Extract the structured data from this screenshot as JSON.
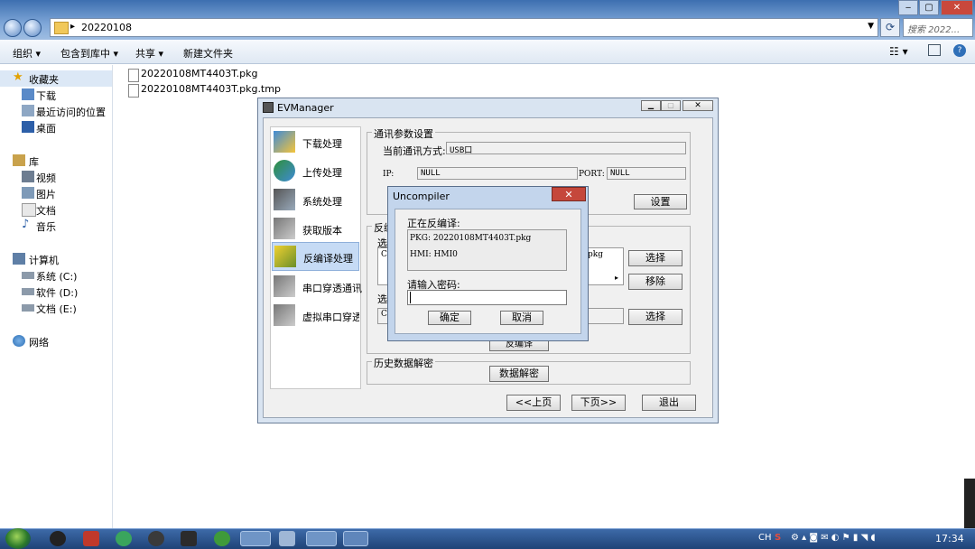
{
  "explorer": {
    "address_path": "20220108",
    "search_placeholder": "搜索 2022...",
    "toolbar": {
      "organize": "组织 ▾",
      "include_library": "包含到库中 ▾",
      "share": "共享 ▾",
      "new_folder": "新建文件夹"
    },
    "sidebar": {
      "favorites": "收藏夹",
      "downloads": "下载",
      "recent": "最近访问的位置",
      "desktop": "桌面",
      "libraries": "库",
      "videos": "视频",
      "pictures": "图片",
      "documents": "文档",
      "music": "音乐",
      "computer": "计算机",
      "drive_c": "系统 (C:)",
      "drive_d": "软件 (D:)",
      "drive_e": "文档 (E:)",
      "network": "网络"
    },
    "files": [
      "20220108MT4403T.pkg",
      "20220108MT4403T.pkg.tmp"
    ]
  },
  "evmanager": {
    "title": "EVManager",
    "nav": [
      "下载处理",
      "上传处理",
      "系统处理",
      "获取版本",
      "反编译处理",
      "串口穿透通讯",
      "虚拟串口穿透"
    ],
    "comm_group": {
      "title": "通讯参数设置",
      "mode_label": "当前通讯方式:",
      "mode_value": "USB口",
      "ip_label": "IP:",
      "ip_value": "NULL",
      "port_label": "PORT:",
      "port_value": "NULL",
      "set_button": "设置"
    },
    "decompile_group": {
      "title": "反编",
      "select_label": "选",
      "path_c": "C:",
      "path_suffix": "pkg",
      "select_button": "选择",
      "remove_button": "移除",
      "select_label2": "选",
      "path_c2": "C:",
      "select_button2": "选择",
      "decompile_button": "反编译"
    },
    "history_group": {
      "title": "历史数据解密",
      "decrypt_button": "数据解密"
    },
    "prev_button": "<<上页",
    "next_button": "下页>>",
    "exit_button": "退出"
  },
  "uncompiler": {
    "title": "Uncompiler",
    "status_label": "正在反编译:",
    "pkg_line": "PKG:  20220108MT4403T.pkg",
    "hmi_line": "HMI:  HMI0",
    "password_label": "请输入密码:",
    "password_value": "",
    "ok_button": "确定",
    "cancel_button": "取消"
  },
  "taskbar": {
    "lang": "CH",
    "clock": "17:34"
  },
  "colors": {
    "selected_nav": "#c6dbf5",
    "dialog_close": "#c5473b",
    "taskbar": "#1f4377"
  }
}
